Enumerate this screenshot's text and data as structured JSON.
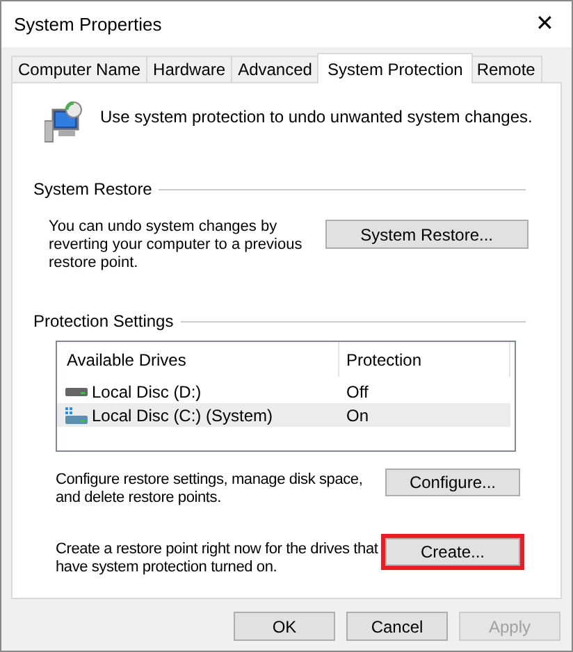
{
  "window": {
    "title": "System Properties",
    "close": "✕"
  },
  "tabs": [
    {
      "label": "Computer Name",
      "selected": false
    },
    {
      "label": "Hardware",
      "selected": false
    },
    {
      "label": "Advanced",
      "selected": false
    },
    {
      "label": "System Protection",
      "selected": true
    },
    {
      "label": "Remote",
      "selected": false
    }
  ],
  "intro": "Use system protection to undo unwanted system changes.",
  "system_restore": {
    "heading": "System Restore",
    "text": "You can undo system changes by reverting your computer to a previous restore point.",
    "button": "System Restore..."
  },
  "protection_settings": {
    "heading": "Protection Settings",
    "columns": [
      "Available Drives",
      "Protection"
    ],
    "drives": [
      {
        "name": "Local Disc (D:)",
        "protection": "Off",
        "system": false,
        "selected": false
      },
      {
        "name": "Local Disc (C:) (System)",
        "protection": "On",
        "system": true,
        "selected": true
      }
    ],
    "configure": {
      "text": "Configure restore settings, manage disk space, and delete restore points.",
      "button": "Configure..."
    },
    "create": {
      "text": "Create a restore point right now for the drives that have system protection turned on.",
      "button": "Create...",
      "highlighted": true
    }
  },
  "buttons": [
    {
      "label": "OK",
      "disabled": false
    },
    {
      "label": "Cancel",
      "disabled": false
    },
    {
      "label": "Apply",
      "disabled": true
    }
  ]
}
